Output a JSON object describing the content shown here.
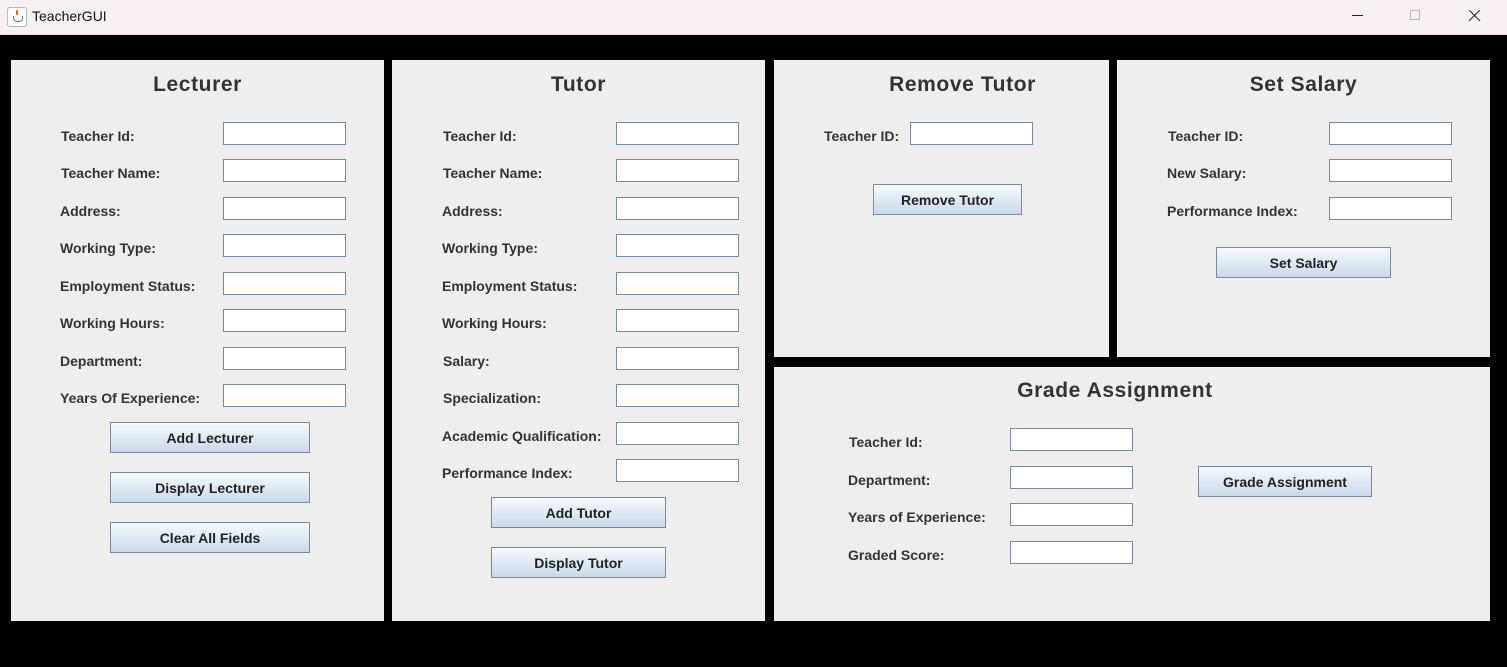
{
  "window": {
    "title": "TeacherGUI"
  },
  "lecturer": {
    "title": "Lecturer",
    "labels": [
      "Teacher Id:",
      "Teacher Name:",
      "Address:",
      "Working Type:",
      "Employment Status:",
      "Working Hours:",
      "Department:",
      "Years Of Experience:"
    ],
    "buttons": {
      "add": "Add Lecturer",
      "display": "Display Lecturer",
      "clear": "Clear All Fields"
    }
  },
  "tutor": {
    "title": "Tutor",
    "labels": [
      "Teacher Id:",
      "Teacher Name:",
      "Address:",
      "Working Type:",
      "Employment Status:",
      "Working Hours:",
      "Salary:",
      "Specialization:",
      "Academic Qualification:",
      "Performance Index:"
    ],
    "buttons": {
      "add": "Add Tutor",
      "display": "Display Tutor"
    }
  },
  "remove_tutor": {
    "title": "Remove Tutor",
    "labels": [
      "Teacher ID:"
    ],
    "buttons": {
      "remove": "Remove Tutor"
    }
  },
  "set_salary": {
    "title": "Set Salary",
    "labels": [
      "Teacher ID:",
      "New Salary:",
      "Performance Index:"
    ],
    "buttons": {
      "set": "Set Salary"
    }
  },
  "grade_assignment": {
    "title": "Grade Assignment",
    "labels": [
      "Teacher Id:",
      "Department:",
      "Years of Experience:",
      "Graded Score:"
    ],
    "buttons": {
      "grade": "Grade Assignment"
    }
  }
}
